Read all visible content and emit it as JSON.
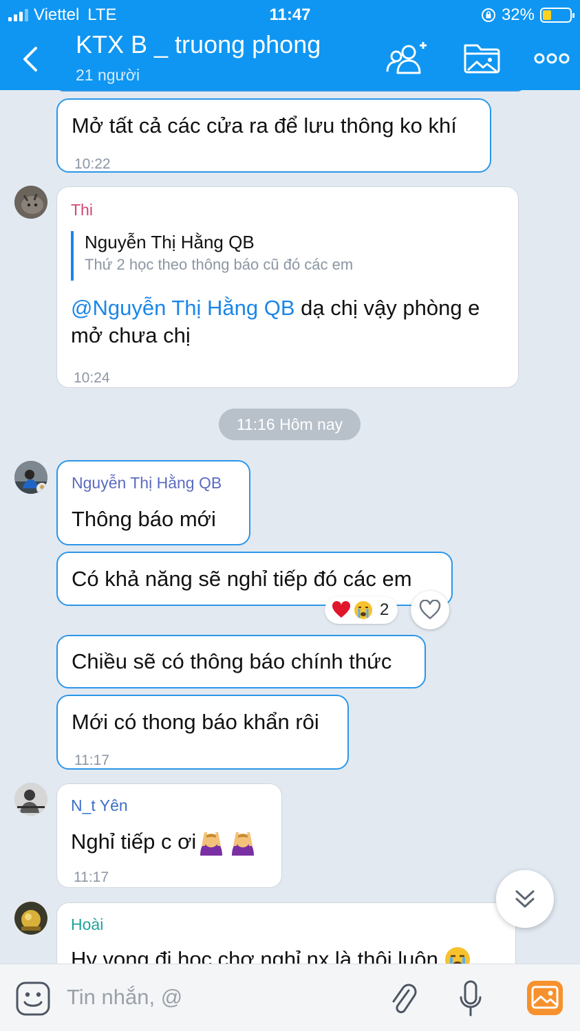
{
  "status_bar": {
    "carrier": "Viettel",
    "network": "LTE",
    "time": "11:47",
    "battery": "32%",
    "battery_level": 0.32
  },
  "header": {
    "title": "KTX B _ truong phong",
    "subtitle": "21 người",
    "icons": [
      "back-icon",
      "add-member-icon",
      "media-folder-icon",
      "more-icon"
    ]
  },
  "messages": {
    "m1": {
      "text": "Mở tất cả các cửa ra để lưu thông ko khí",
      "time": "10:22"
    },
    "m2": {
      "sender": "Thi",
      "quote_author": "Nguyễn Thị Hằng QB",
      "quote_text": "Thứ 2 học theo thông báo cũ đó các em",
      "mention": "@Nguyễn Thị Hằng QB",
      "text_line1": " dạ chị vậy phòng e",
      "text_line2": "mở chưa chị",
      "time": "10:24"
    },
    "divider": "11:16 Hôm nay",
    "m3": {
      "sender": "Nguyễn Thị Hằng QB",
      "text": "Thông báo mới"
    },
    "m4": {
      "text": "Có khả năng sẽ nghỉ tiếp đó các em",
      "reaction_count": "2",
      "reactions": [
        "heart-icon",
        "crying-face-icon"
      ]
    },
    "m5": {
      "text": "Chiều sẽ có thông báo chính thức"
    },
    "m6": {
      "text": "Mới có thong báo khẩn rôi",
      "time": "11:17"
    },
    "m7": {
      "sender": "N_t Yên",
      "text": "Nghỉ tiếp c ơi",
      "time": "11:17"
    },
    "m8": {
      "sender": "Hoài",
      "text": "Hy vọng đi học chơ nghỉ nx là thôi luôn"
    }
  },
  "input": {
    "placeholder": "Tin nhắn, @"
  },
  "colors": {
    "header_bg": "#0f96f2",
    "chat_bg": "#e2e9f1",
    "bubble_border": "#2b96e8",
    "mention": "#1a86e8",
    "sender_thi": "#d2467a",
    "sender_hang": "#5b6bc0",
    "sender_yen": "#3b6fc6",
    "sender_hoai": "#1fa39a"
  }
}
